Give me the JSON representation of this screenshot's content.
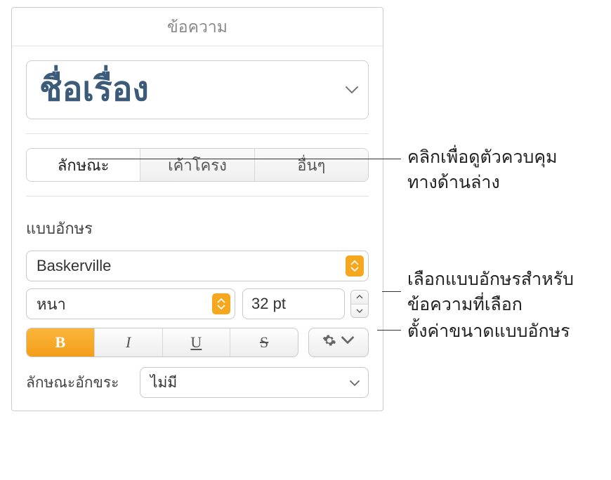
{
  "header": {
    "title": "ข้อความ"
  },
  "style_picker": {
    "name": "ชื่อเรื่อง"
  },
  "tabs": {
    "style": "ลักษณะ",
    "layout": "เค้าโครง",
    "more": "อื่นๆ"
  },
  "font_section": {
    "label": "แบบอักษร",
    "family": "Baskerville",
    "weight": "หนา",
    "size": "32 pt"
  },
  "style_buttons": {
    "bold": "B",
    "italic": "I",
    "underline": "U",
    "strike": "S"
  },
  "char_style": {
    "label": "ลักษณะอักขระ",
    "value": "ไม่มี"
  },
  "callouts": {
    "tabs_line1": "คลิกเพื่อดูตัวควบคุม",
    "tabs_line2": "ทางด้านล่าง",
    "font_line1": "เลือกแบบอักษรสำหรับ",
    "font_line2": "ข้อความที่เลือก",
    "size": "ตั้งค่าขนาดแบบอักษร"
  }
}
